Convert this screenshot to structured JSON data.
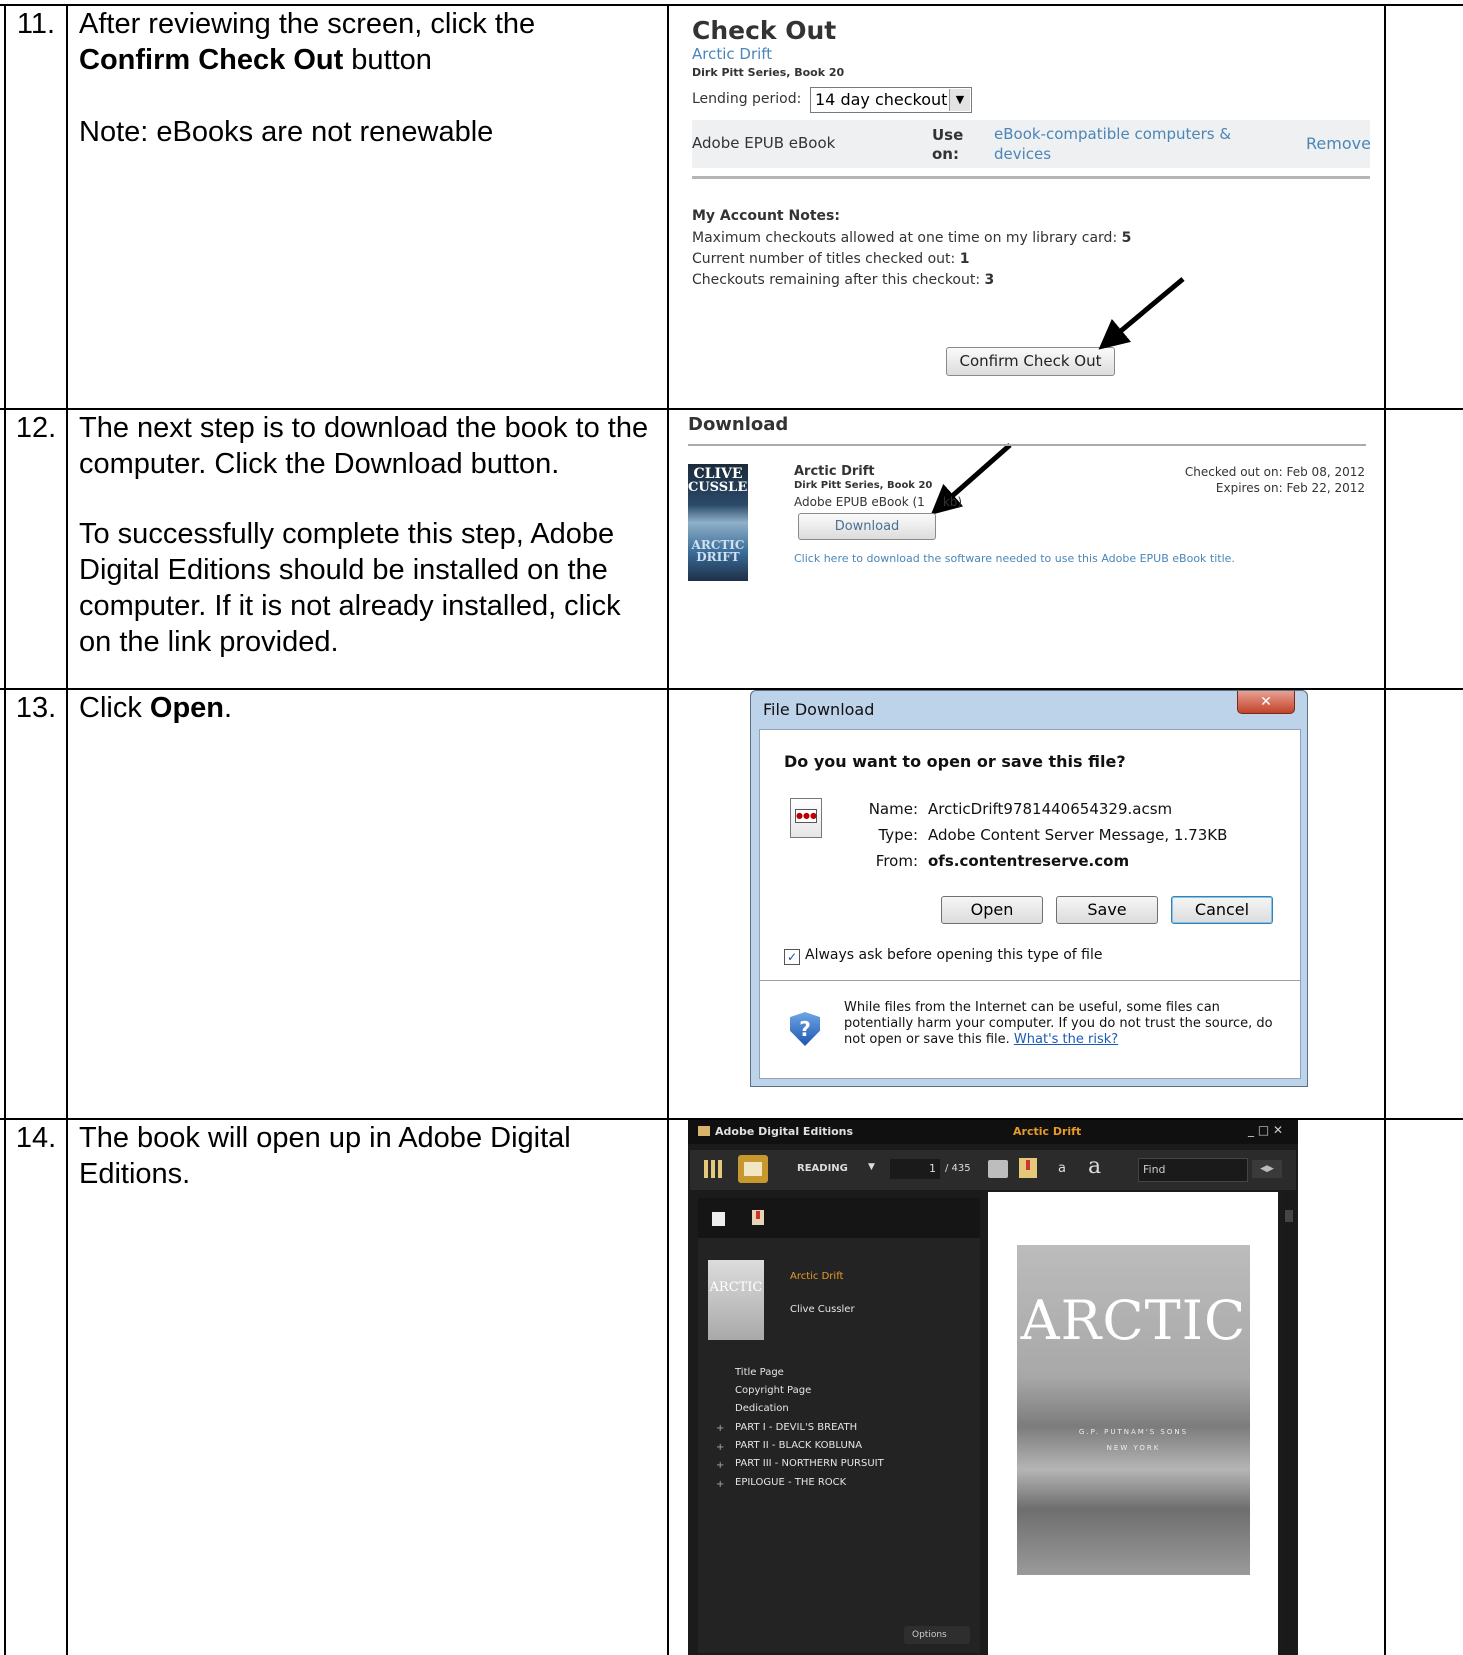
{
  "steps": [
    {
      "number": "11.",
      "line1": "After reviewing the screen, click the",
      "bold": "Confirm Check Out",
      "after_bold": " button",
      "note": "Note:  eBooks are not renewable"
    },
    {
      "number": "12.",
      "text1": "The next step is to download the book to the computer. Click the Download button.",
      "text2": "To successfully complete this step, Adobe Digital Editions should be installed on the computer.  If it is not already installed, click on the link provided."
    },
    {
      "number": "13.",
      "prefix": "Click ",
      "bold": "Open",
      "suffix": "."
    },
    {
      "number": "14.",
      "text": "The book will open up in Adobe Digital Editions."
    }
  ],
  "checkout": {
    "heading": "Check Out",
    "book_title": "Arctic Drift",
    "series": "Dirk Pitt Series, Book 20",
    "lending_label": "Lending period:",
    "lending_value": "14 day checkout",
    "format": "Adobe EPUB eBook",
    "use_on": "Use on:",
    "use_link": "eBook-compatible computers & devices",
    "remove": "Remove",
    "notes_heading": "My Account Notes:",
    "max_label": "Maximum checkouts allowed at one time on my library card: ",
    "max_value": "5",
    "current_label": "Current number of titles checked out: ",
    "current_value": "1",
    "remaining_label": "Checkouts remaining after this checkout: ",
    "remaining_value": "3",
    "confirm_button": "Confirm Check Out"
  },
  "download": {
    "heading": "Download",
    "cover_line1": "CLIVE",
    "cover_line2": "CUSSLER",
    "cover_line3": "ARCTIC",
    "cover_line4": "DRIFT",
    "book_title": "Arctic Drift",
    "series": "Dirk Pitt Series, Book 20",
    "format": "Adobe EPUB eBook (1",
    "format_end": "kb)",
    "checked_out_label": "Checked out on:",
    "checked_out_value": "Feb 08, 2012",
    "expires_label": "Expires on:",
    "expires_value": "Feb 22, 2012",
    "button": "Download",
    "software_link": "Click here to download the software needed to use this Adobe EPUB eBook title."
  },
  "file_dialog": {
    "title": "File Download",
    "question": "Do you want to open or save this file?",
    "name_label": "Name:",
    "name_value": "ArcticDrift9781440654329.acsm",
    "type_label": "Type:",
    "type_value": "Adobe Content Server Message, 1.73KB",
    "from_label": "From:",
    "from_value": "ofs.contentreserve.com",
    "open": "Open",
    "save": "Save",
    "cancel": "Cancel",
    "checkbox_label": "Always ask before opening this type of file",
    "warning": "While files from the Internet can be useful, some files can potentially harm your computer. If you do not trust the source, do not open or save this file. ",
    "risk_link": "What's the risk?"
  },
  "ade": {
    "app_name": "Adobe Digital Editions",
    "book_title": "Arctic Drift",
    "view_mode": "READING",
    "page": "1",
    "page_total": "/ 435",
    "find_placeholder": "Find",
    "font_small": "a",
    "font_large": "a",
    "sidebar_title": "Arctic Drift",
    "sidebar_author": "Clive Cussler",
    "thumb_text": "ARCTIC",
    "toc": [
      "Title Page",
      "Copyright Page",
      "Dedication",
      "PART I - DEVIL'S BREATH",
      "PART II - BLACK KOBLUNA",
      "PART III - NORTHERN PURSUIT",
      "EPILOGUE - THE ROCK"
    ],
    "options": "Options",
    "page_word": "ARCTIC",
    "publisher": "G.P. PUTNAM'S SONS",
    "city": "NEW YORK"
  }
}
